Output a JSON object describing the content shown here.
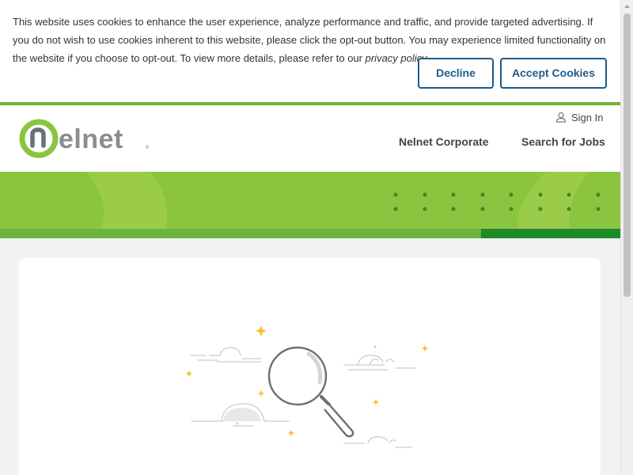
{
  "cookie_banner": {
    "text_before": "This website uses cookies to enhance the user experience, analyze performance and traffic, and provide targeted advertising. If you do not wish to use cookies inherent to this website, please click the opt-out button. You may experience limited functionality on the website if you choose to opt-out. To view more details, please refer to our ",
    "link_text": "privacy policy",
    "text_after": ".",
    "decline_label": "Decline",
    "accept_label": "Accept Cookies"
  },
  "header": {
    "logo_text": "nelnet",
    "signin_label": "Sign In",
    "nav": {
      "corporate": "Nelnet Corporate",
      "jobs": "Search for Jobs"
    }
  },
  "colors": {
    "brand_green": "#8bc540",
    "dark_green": "#1e8a28",
    "button_blue": "#1e5b8a",
    "logo_gray": "#8a8d90"
  },
  "icons": {
    "signin": "user-icon",
    "illustration": "magnifying-glass-icon"
  }
}
